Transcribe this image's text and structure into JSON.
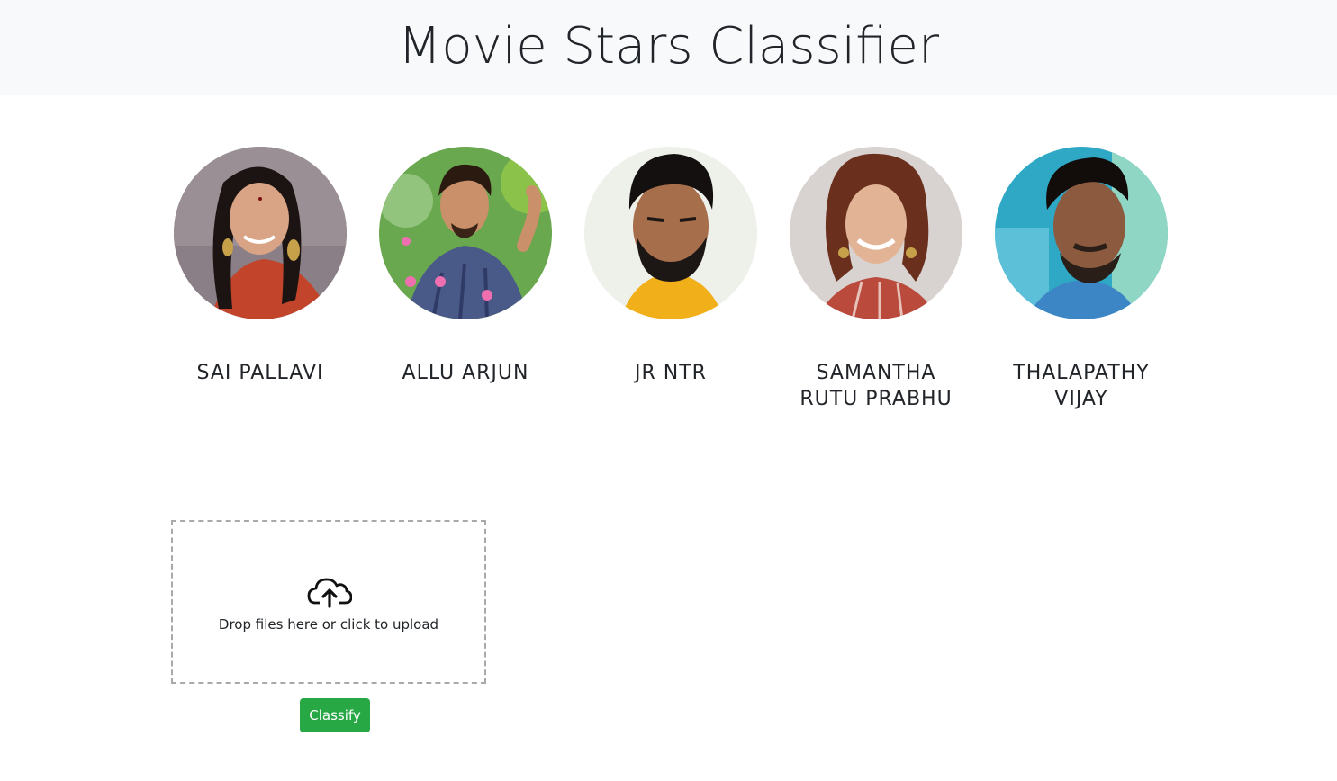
{
  "header": {
    "title": "Movie Stars Classifier"
  },
  "celebrities": [
    {
      "name": "SAI PALLAVI",
      "photo": "sai-pallavi-photo"
    },
    {
      "name": "ALLU ARJUN",
      "photo": "allu-arjun-photo"
    },
    {
      "name": "JR NTR",
      "photo": "jr-ntr-photo"
    },
    {
      "name": "SAMANTHA RUTU PRABHU",
      "photo": "samantha-photo"
    },
    {
      "name": "THALAPATHY VIJAY",
      "photo": "vijay-photo"
    }
  ],
  "upload": {
    "icon": "cloud-upload-icon",
    "message": "Drop files here or click to upload"
  },
  "actions": {
    "classify_label": "Classify"
  },
  "colors": {
    "header_bg": "#f8f9fa",
    "button_green": "#28a745",
    "dropzone_border": "#a9a9a9"
  }
}
